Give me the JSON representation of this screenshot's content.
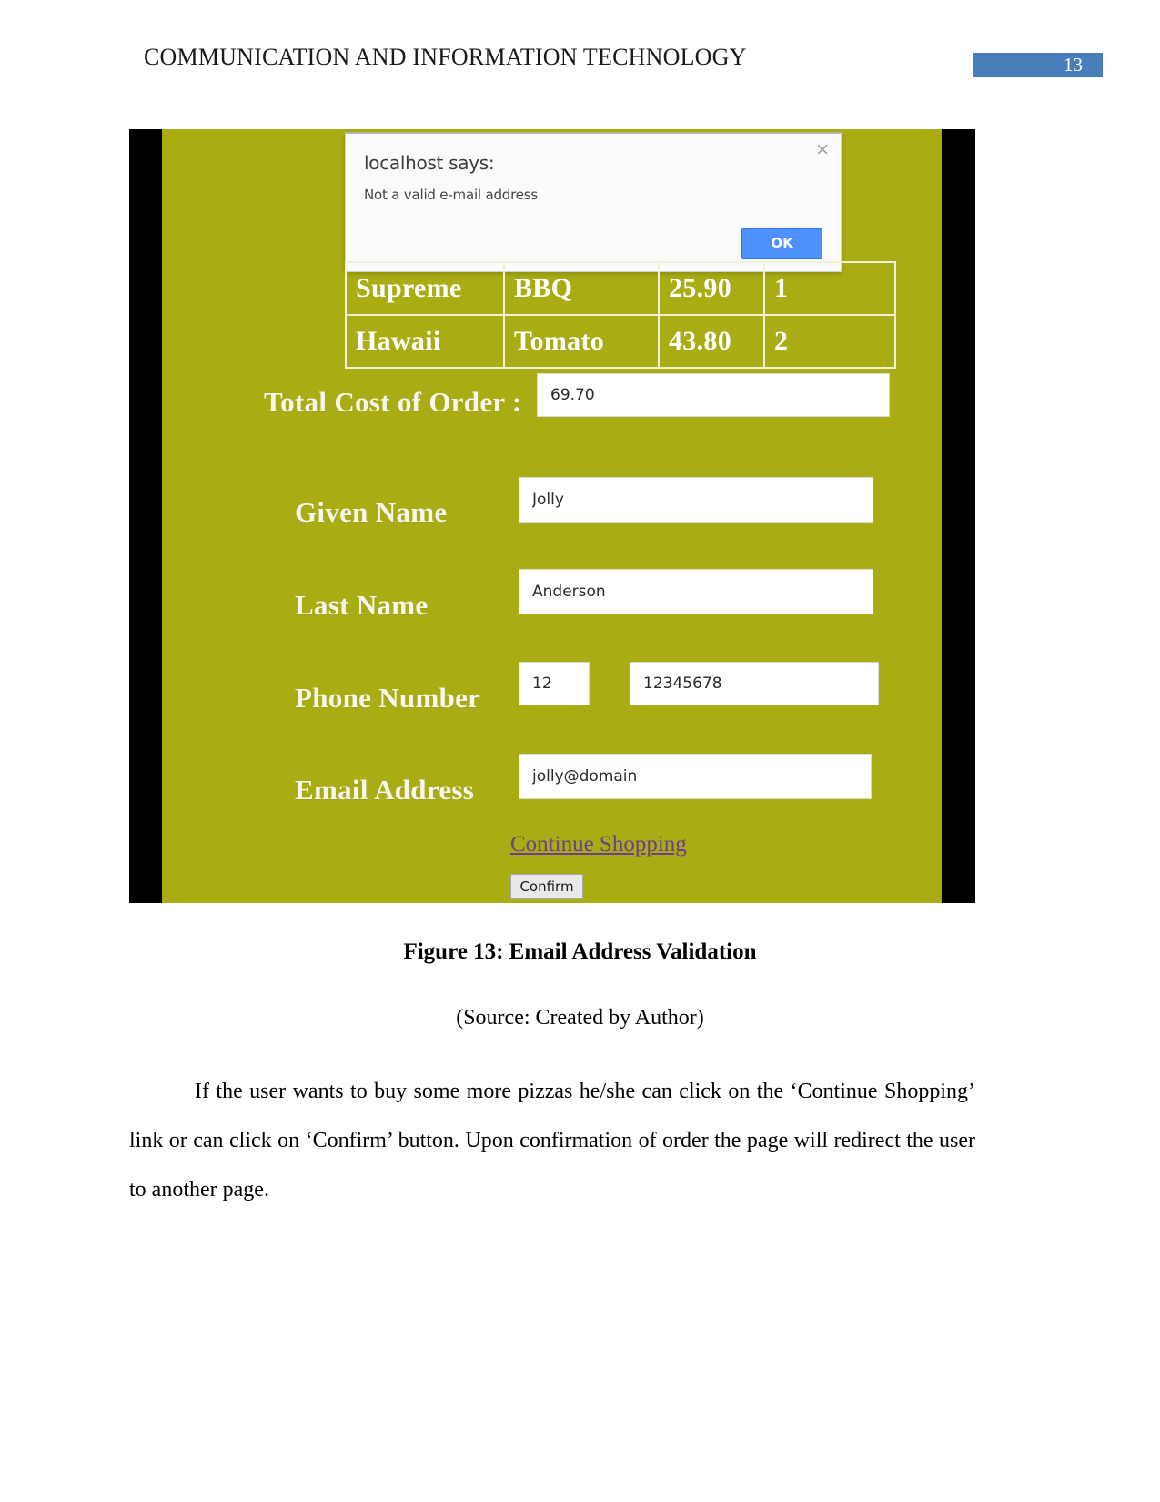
{
  "header": {
    "title": "COMMUNICATION AND INFORMATION TECHNOLOGY",
    "page_number": "13",
    "badge_color": "#4a7ebb"
  },
  "figure": {
    "caption": "Figure 13: Email Address Validation",
    "source": "(Source: Created by Author)",
    "background_color": "#a9ad13",
    "alert": {
      "title": "localhost says:",
      "message": "Not a valid e-mail address",
      "close_icon": "×",
      "ok_label": "OK",
      "ok_color": "#4d90fe"
    },
    "order_table": {
      "rows": [
        {
          "name": "Supreme",
          "topping": "BBQ",
          "price": "25.90",
          "quantity": "1"
        },
        {
          "name": "Hawaii",
          "topping": "Tomato",
          "price": "43.80",
          "quantity": "2"
        }
      ]
    },
    "form": {
      "total_label": "Total Cost of Order :",
      "total_value": "69.70",
      "given_name_label": "Given Name",
      "given_name_value": "Jolly",
      "last_name_label": "Last Name",
      "last_name_value": "Anderson",
      "phone_label": "Phone Number",
      "phone_code_value": "12",
      "phone_number_value": "12345678",
      "email_label": "Email Address",
      "email_value": "jolly@domain",
      "continue_link": "Continue Shopping",
      "confirm_label": "Confirm",
      "link_color": "#6b3f8f"
    }
  },
  "body": {
    "paragraph": "If the user wants to buy some more pizzas he/she can click on the ‘Continue Shopping’ link or can click on ‘Confirm’ button. Upon confirmation of order the page will redirect the user to another page."
  }
}
